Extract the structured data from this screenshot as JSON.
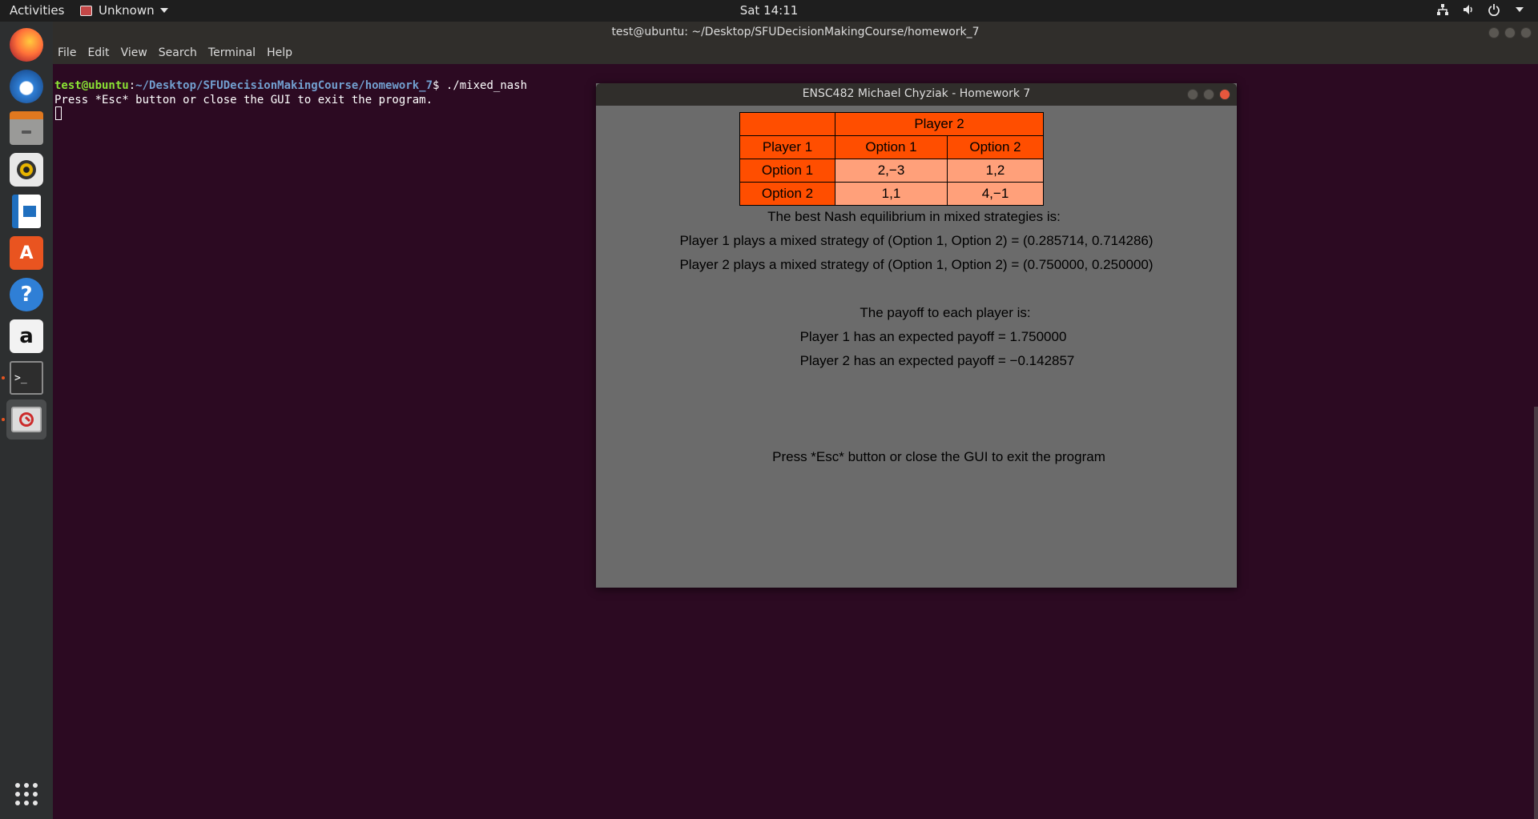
{
  "topbar": {
    "activities": "Activities",
    "app_name": "Unknown",
    "clock": "Sat 14:11",
    "tray_icons": [
      "network-icon",
      "volume-icon",
      "power-icon",
      "chevron-down-icon"
    ]
  },
  "terminal": {
    "title": "test@ubuntu: ~/Desktop/SFUDecisionMakingCourse/homework_7",
    "menu": [
      "File",
      "Edit",
      "View",
      "Search",
      "Terminal",
      "Help"
    ],
    "prompt_user": "test@ubuntu",
    "prompt_sep": ":",
    "prompt_path": "~/Desktop/SFUDecisionMakingCourse/homework_7",
    "prompt_end": "$ ./mixed_nash",
    "output_line": "Press *Esc* button or close the GUI to exit the program."
  },
  "dock": {
    "items": [
      "firefox-icon",
      "thunderbird-icon",
      "files-icon",
      "rhythmbox-icon",
      "libreoffice-writer-icon",
      "software-center-icon",
      "help-icon",
      "amazon-icon",
      "terminal-icon",
      "gui-app-icon",
      "show-applications-icon"
    ]
  },
  "gui": {
    "title": "ENSC482 Michael Chyziak - Homework 7",
    "table": {
      "player2": "Player 2",
      "player1": "Player 1",
      "col_headers": [
        "Option 1",
        "Option 2"
      ],
      "rows": [
        {
          "label": "Option 1",
          "cells": [
            "2,−3",
            "1,2"
          ]
        },
        {
          "label": "Option 2",
          "cells": [
            "1,1",
            "4,−1"
          ]
        }
      ]
    },
    "equilibrium_heading": "The best Nash equilibrium in mixed strategies is:",
    "p1_strategy": "Player 1 plays a mixed strategy of (Option 1, Option 2) = (0.285714, 0.714286)",
    "p2_strategy": "Player 2 plays a mixed strategy of (Option 1, Option 2) = (0.750000, 0.250000)",
    "payoff_heading": "The payoff to each player is:",
    "p1_payoff": "Player 1 has an expected payoff = 1.750000",
    "p2_payoff": "Player 2 has an expected payoff = −0.142857",
    "exit_hint": "Press *Esc* button or close the GUI to exit the program"
  }
}
